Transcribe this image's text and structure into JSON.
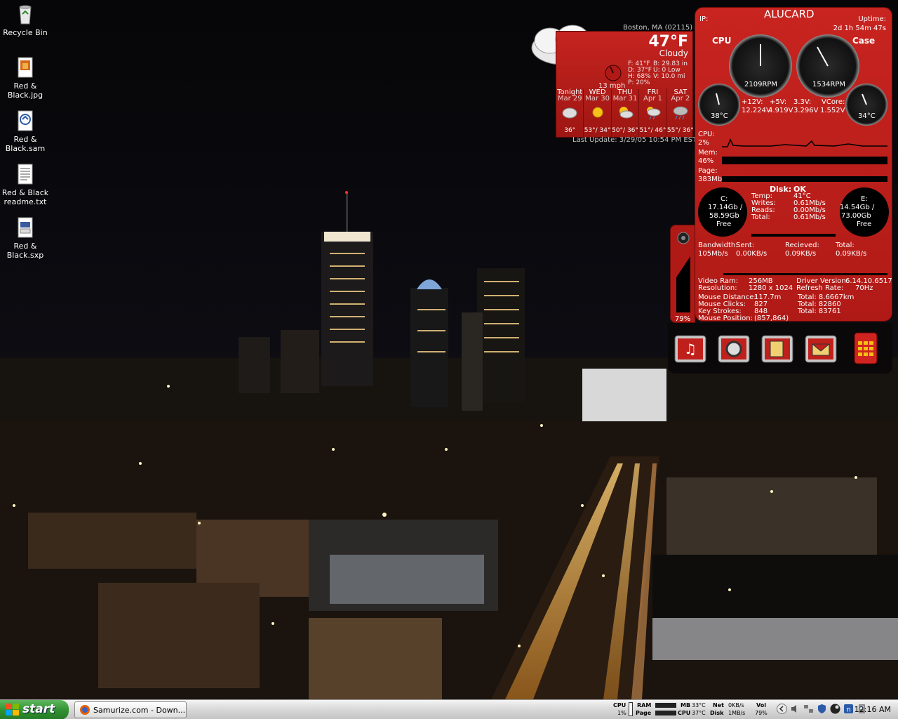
{
  "desktop": {
    "icons": [
      {
        "label": "Recycle Bin",
        "icon": "recycle-bin-icon"
      },
      {
        "label": "Red & Black.jpg",
        "icon": "image-file-icon"
      },
      {
        "label": "Red & Black.sam",
        "icon": "sam-file-icon"
      },
      {
        "label": "Red & Black readme.txt",
        "icon": "text-file-icon"
      },
      {
        "label": "Red & Black.sxp",
        "icon": "sxp-file-icon"
      }
    ]
  },
  "weather": {
    "location": "Boston, MA (02115)",
    "temp": "47°F",
    "condition": "Cloudy",
    "wind": "13 mph",
    "details": [
      "F: 41°F",
      "D: 37°F",
      "H: 68%",
      "P: 20%"
    ],
    "details2": [
      "B:  29.83 in",
      "U: 0 Low",
      "V: 10.0 mi"
    ],
    "forecast": [
      {
        "day": "Tonight",
        "date": "Mar 29",
        "temps": "36°",
        "icon": "cloud-icon"
      },
      {
        "day": "WED",
        "date": "Mar 30",
        "temps": "53°/ 34°",
        "icon": "sun-icon"
      },
      {
        "day": "THU",
        "date": "Mar 31",
        "temps": "50°/ 36°",
        "icon": "partly-cloudy-icon"
      },
      {
        "day": "FRI",
        "date": "Apr 1",
        "temps": "51°/ 46°",
        "icon": "showers-icon"
      },
      {
        "day": "SAT",
        "date": "Apr 2",
        "temps": "55°/ 36°",
        "icon": "rain-icon"
      }
    ],
    "last_update": "Last Update: 3/29/05 10:54 PM EST"
  },
  "sys": {
    "ip_label": "IP:",
    "hostname": "ALUCARD",
    "uptime_label": "Uptime:",
    "uptime": "2d 1h 54m 47s",
    "cpu_label": "CPU",
    "case_label": "Case",
    "fan1": "2109RPM",
    "fan2": "1534RPM",
    "temp_cpu": "38°C",
    "temp_case": "34°C",
    "voltages": [
      {
        "label": "+12V:",
        "value": "12.224V"
      },
      {
        "label": "+5V:",
        "value": "4.919V"
      },
      {
        "label": "3.3V:",
        "value": "3.296V"
      },
      {
        "label": "VCore:",
        "value": "1.552V"
      }
    ],
    "cpu_usage_label": "CPU:",
    "cpu_usage": "2%",
    "mem_label": "Mem:",
    "mem_usage": "46%",
    "page_label": "Page:",
    "page_usage": "383Mb",
    "disk_label": "Disk:",
    "disk_status": "OK",
    "drive_c": {
      "label": "C:",
      "used": "17.14Gb /",
      "total": "58.59Gb",
      "free": "Free"
    },
    "drive_e": {
      "label": "E:",
      "used": "14.54Gb /",
      "total": "73.00Gb",
      "free": "Free"
    },
    "disk_stats": [
      {
        "label": "Temp:",
        "value": "41°C"
      },
      {
        "label": "Writes:",
        "value": "0.61Mb/s"
      },
      {
        "label": "Reads:",
        "value": "0.00Mb/s"
      },
      {
        "label": "Total:",
        "value": "0.61Mb/s"
      }
    ],
    "bandwidth_label": "Bandwidth:",
    "bandwidth": "105Mb/s",
    "sent_label": "Sent:",
    "sent": "0.00KB/s",
    "received_label": "Recieved:",
    "received": "0.09KB/s",
    "total_label": "Total:",
    "total": "0.09KB/s",
    "video": [
      {
        "label": "Video Ram:",
        "value": "256MB"
      },
      {
        "label": "Resolution:",
        "value": "1280 x 1024"
      }
    ],
    "video_right": [
      {
        "label": "Driver Version:",
        "value": "6.14.10.6517"
      },
      {
        "label": "Refresh Rate:",
        "value": "70Hz"
      }
    ],
    "mouse": [
      {
        "label": "Mouse Distance:",
        "value": "117.7m"
      },
      {
        "label": "Mouse Clicks:",
        "value": "827"
      },
      {
        "label": "Key Strokes:",
        "value": "848"
      },
      {
        "label": "Mouse Position:",
        "value": "(857,864)"
      }
    ],
    "mouse_totals": [
      "Total: 8.6667km",
      "Total: 82860",
      "Total: 83761"
    ],
    "volume": "79%"
  },
  "launcher": {
    "buttons": [
      "music-icon",
      "settings-icon",
      "files-icon",
      "mail-icon",
      "calculator-icon"
    ]
  },
  "taskbar": {
    "start_label": "start",
    "task_label": "Samurize.com - Down...",
    "tray": {
      "cpu": "CPU",
      "cpu_val": "1%",
      "ram": "RAM",
      "page": "Page",
      "mb": "MB",
      "mb_temp": "33°C",
      "cpu2": "CPU",
      "cpu_temp": "37°C",
      "net": "Net",
      "disk": "Disk",
      "net_down": "0KB/s",
      "net_up": "1MB/s",
      "vol": "Vol",
      "vol_val": "79%"
    },
    "clock": "12:16 AM"
  }
}
